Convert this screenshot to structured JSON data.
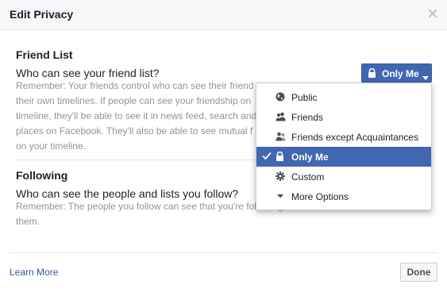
{
  "dialog": {
    "title": "Edit Privacy",
    "close_icon": "close-icon"
  },
  "friend_list": {
    "title": "Friend List",
    "question": "Who can see your friend list?",
    "remember_lines": [
      "Remember: Your friends control who can see their friend",
      "their own timelines. If people can see your friendship on",
      "timeline, they'll be able to see it in news feed, search and",
      "places on Facebook. They'll also be able to see mutual f",
      "on your timeline."
    ]
  },
  "following": {
    "title": "Following",
    "question": "Who can see the people and lists you follow?",
    "remember_lines": [
      "Remember: The people you follow can see that you're following",
      "them."
    ]
  },
  "privacy_button": {
    "label": "Only Me",
    "icon": "lock-icon",
    "accent": "#4267b2"
  },
  "menu": {
    "items": [
      {
        "label": "Public",
        "icon": "globe-icon",
        "selected": false
      },
      {
        "label": "Friends",
        "icon": "friends-icon",
        "selected": false
      },
      {
        "label": "Friends except Acquaintances",
        "icon": "friends-except-icon",
        "selected": false
      },
      {
        "label": "Only Me",
        "icon": "lock-icon",
        "selected": true
      },
      {
        "label": "Custom",
        "icon": "gear-icon",
        "selected": false
      },
      {
        "label": "More Options",
        "icon": "caret-down-icon",
        "selected": false
      }
    ]
  },
  "footer": {
    "learn_more": "Learn More",
    "done": "Done"
  }
}
